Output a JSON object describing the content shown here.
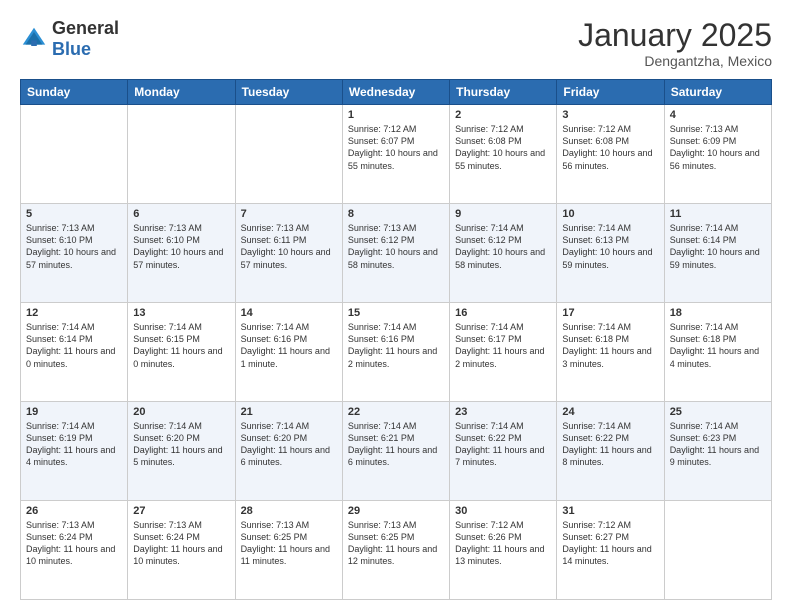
{
  "header": {
    "logo_general": "General",
    "logo_blue": "Blue",
    "month_title": "January 2025",
    "location": "Dengantzha, Mexico"
  },
  "days_of_week": [
    "Sunday",
    "Monday",
    "Tuesday",
    "Wednesday",
    "Thursday",
    "Friday",
    "Saturday"
  ],
  "weeks": [
    [
      {
        "day": "",
        "info": ""
      },
      {
        "day": "",
        "info": ""
      },
      {
        "day": "",
        "info": ""
      },
      {
        "day": "1",
        "info": "Sunrise: 7:12 AM\nSunset: 6:07 PM\nDaylight: 10 hours and 55 minutes."
      },
      {
        "day": "2",
        "info": "Sunrise: 7:12 AM\nSunset: 6:08 PM\nDaylight: 10 hours and 55 minutes."
      },
      {
        "day": "3",
        "info": "Sunrise: 7:12 AM\nSunset: 6:08 PM\nDaylight: 10 hours and 56 minutes."
      },
      {
        "day": "4",
        "info": "Sunrise: 7:13 AM\nSunset: 6:09 PM\nDaylight: 10 hours and 56 minutes."
      }
    ],
    [
      {
        "day": "5",
        "info": "Sunrise: 7:13 AM\nSunset: 6:10 PM\nDaylight: 10 hours and 57 minutes."
      },
      {
        "day": "6",
        "info": "Sunrise: 7:13 AM\nSunset: 6:10 PM\nDaylight: 10 hours and 57 minutes."
      },
      {
        "day": "7",
        "info": "Sunrise: 7:13 AM\nSunset: 6:11 PM\nDaylight: 10 hours and 57 minutes."
      },
      {
        "day": "8",
        "info": "Sunrise: 7:13 AM\nSunset: 6:12 PM\nDaylight: 10 hours and 58 minutes."
      },
      {
        "day": "9",
        "info": "Sunrise: 7:14 AM\nSunset: 6:12 PM\nDaylight: 10 hours and 58 minutes."
      },
      {
        "day": "10",
        "info": "Sunrise: 7:14 AM\nSunset: 6:13 PM\nDaylight: 10 hours and 59 minutes."
      },
      {
        "day": "11",
        "info": "Sunrise: 7:14 AM\nSunset: 6:14 PM\nDaylight: 10 hours and 59 minutes."
      }
    ],
    [
      {
        "day": "12",
        "info": "Sunrise: 7:14 AM\nSunset: 6:14 PM\nDaylight: 11 hours and 0 minutes."
      },
      {
        "day": "13",
        "info": "Sunrise: 7:14 AM\nSunset: 6:15 PM\nDaylight: 11 hours and 0 minutes."
      },
      {
        "day": "14",
        "info": "Sunrise: 7:14 AM\nSunset: 6:16 PM\nDaylight: 11 hours and 1 minute."
      },
      {
        "day": "15",
        "info": "Sunrise: 7:14 AM\nSunset: 6:16 PM\nDaylight: 11 hours and 2 minutes."
      },
      {
        "day": "16",
        "info": "Sunrise: 7:14 AM\nSunset: 6:17 PM\nDaylight: 11 hours and 2 minutes."
      },
      {
        "day": "17",
        "info": "Sunrise: 7:14 AM\nSunset: 6:18 PM\nDaylight: 11 hours and 3 minutes."
      },
      {
        "day": "18",
        "info": "Sunrise: 7:14 AM\nSunset: 6:18 PM\nDaylight: 11 hours and 4 minutes."
      }
    ],
    [
      {
        "day": "19",
        "info": "Sunrise: 7:14 AM\nSunset: 6:19 PM\nDaylight: 11 hours and 4 minutes."
      },
      {
        "day": "20",
        "info": "Sunrise: 7:14 AM\nSunset: 6:20 PM\nDaylight: 11 hours and 5 minutes."
      },
      {
        "day": "21",
        "info": "Sunrise: 7:14 AM\nSunset: 6:20 PM\nDaylight: 11 hours and 6 minutes."
      },
      {
        "day": "22",
        "info": "Sunrise: 7:14 AM\nSunset: 6:21 PM\nDaylight: 11 hours and 6 minutes."
      },
      {
        "day": "23",
        "info": "Sunrise: 7:14 AM\nSunset: 6:22 PM\nDaylight: 11 hours and 7 minutes."
      },
      {
        "day": "24",
        "info": "Sunrise: 7:14 AM\nSunset: 6:22 PM\nDaylight: 11 hours and 8 minutes."
      },
      {
        "day": "25",
        "info": "Sunrise: 7:14 AM\nSunset: 6:23 PM\nDaylight: 11 hours and 9 minutes."
      }
    ],
    [
      {
        "day": "26",
        "info": "Sunrise: 7:13 AM\nSunset: 6:24 PM\nDaylight: 11 hours and 10 minutes."
      },
      {
        "day": "27",
        "info": "Sunrise: 7:13 AM\nSunset: 6:24 PM\nDaylight: 11 hours and 10 minutes."
      },
      {
        "day": "28",
        "info": "Sunrise: 7:13 AM\nSunset: 6:25 PM\nDaylight: 11 hours and 11 minutes."
      },
      {
        "day": "29",
        "info": "Sunrise: 7:13 AM\nSunset: 6:25 PM\nDaylight: 11 hours and 12 minutes."
      },
      {
        "day": "30",
        "info": "Sunrise: 7:12 AM\nSunset: 6:26 PM\nDaylight: 11 hours and 13 minutes."
      },
      {
        "day": "31",
        "info": "Sunrise: 7:12 AM\nSunset: 6:27 PM\nDaylight: 11 hours and 14 minutes."
      },
      {
        "day": "",
        "info": ""
      }
    ]
  ],
  "colors": {
    "header_bg": "#2b6cb0",
    "alt_row_bg": "#eef2f9",
    "normal_row_bg": "#ffffff"
  }
}
